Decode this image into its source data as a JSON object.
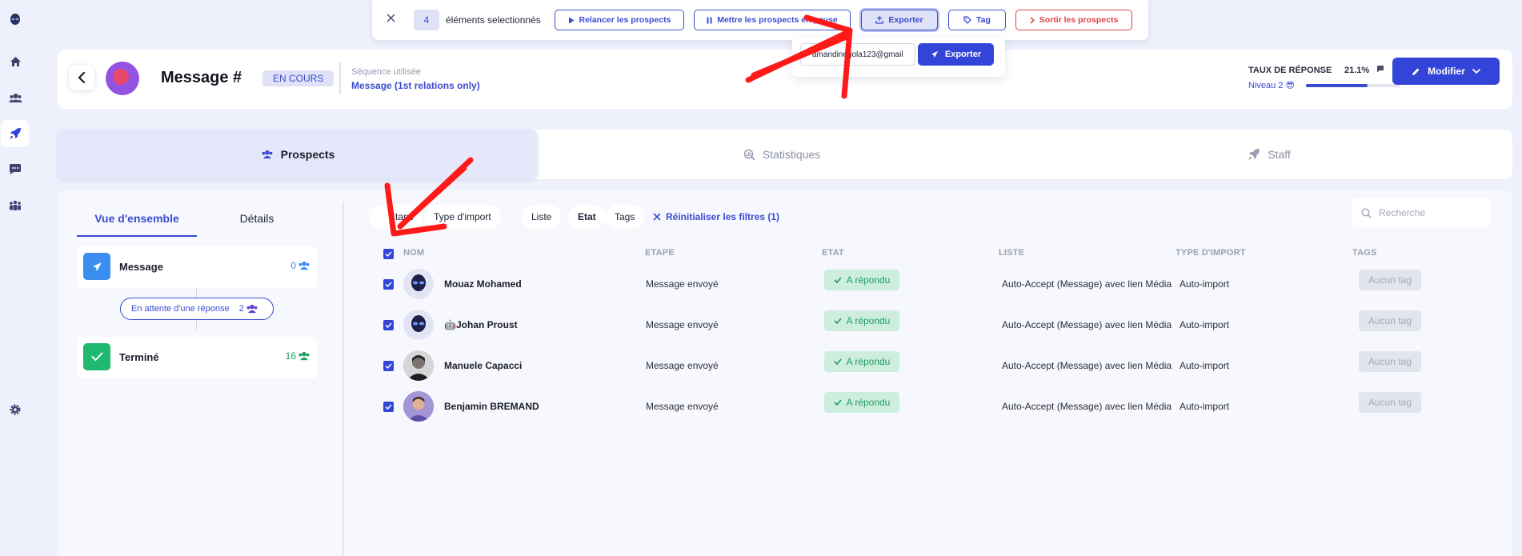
{
  "action_bar": {
    "selected_count": "4",
    "selected_label": "éléments selectionnés",
    "buttons": {
      "relancer": "Relancer les prospects",
      "pause": "Mettre les prospects en pause",
      "exporter": "Exporter",
      "tag": "Tag",
      "sortir": "Sortir les prospects"
    },
    "export_popover": {
      "email_value": "amandinegola123@gmail",
      "button": "Exporter"
    }
  },
  "header": {
    "title": "Message #",
    "status": "EN COURS",
    "sequence_label": "Séquence utilisée",
    "sequence_value": "Message (1st relations only)",
    "response_rate_label": "TAUX DE RÉPONSE",
    "response_rate_value": "21.1%",
    "level_label": "Niveau 2 😎",
    "level_progress": 0.65,
    "modify_button": "Modifier"
  },
  "tabs": {
    "prospects": "Prospects",
    "statistiques": "Statistiques",
    "staff": "Staff"
  },
  "overview": {
    "subtab_overview": "Vue d'ensemble",
    "subtab_details": "Détails",
    "steps": [
      {
        "label": "Message",
        "count": "0"
      },
      {
        "label": "Terminé",
        "count": "16"
      }
    ],
    "pending": {
      "label": "En attente d'une réponse",
      "count": "2"
    }
  },
  "filters": {
    "items": [
      "Etape",
      "Type d'import",
      "Liste",
      "Etat",
      "Tags"
    ],
    "reset": "Réinitialiser les filtres (1)",
    "search_placeholder": "Recherche"
  },
  "table": {
    "columns": [
      "NOM",
      "ETAPE",
      "ETAT",
      "LISTE",
      "TYPE D'IMPORT",
      "TAGS"
    ],
    "rows": [
      {
        "name": "Mouaz Mohamed",
        "etape": "Message envoyé",
        "etat": "A répondu",
        "liste": "Auto-Accept (Message) avec lien Média",
        "import": "Auto-import",
        "tags": "Aucun tag"
      },
      {
        "name": "🤖Johan Proust",
        "etape": "Message envoyé",
        "etat": "A répondu",
        "liste": "Auto-Accept (Message) avec lien Média",
        "import": "Auto-import",
        "tags": "Aucun tag"
      },
      {
        "name": "Manuele Capacci",
        "etape": "Message envoyé",
        "etat": "A répondu",
        "liste": "Auto-Accept (Message) avec lien Média",
        "import": "Auto-import",
        "tags": "Aucun tag"
      },
      {
        "name": "Benjamin BREMAND",
        "etape": "Message envoyé",
        "etat": "A répondu",
        "liste": "Auto-Accept (Message) avec lien Média",
        "import": "Auto-import",
        "tags": "Aucun tag"
      }
    ]
  },
  "colors": {
    "accent": "#3344d8",
    "success": "#1e9d60",
    "danger": "#e04444",
    "annotation": "#ff1a1a"
  }
}
